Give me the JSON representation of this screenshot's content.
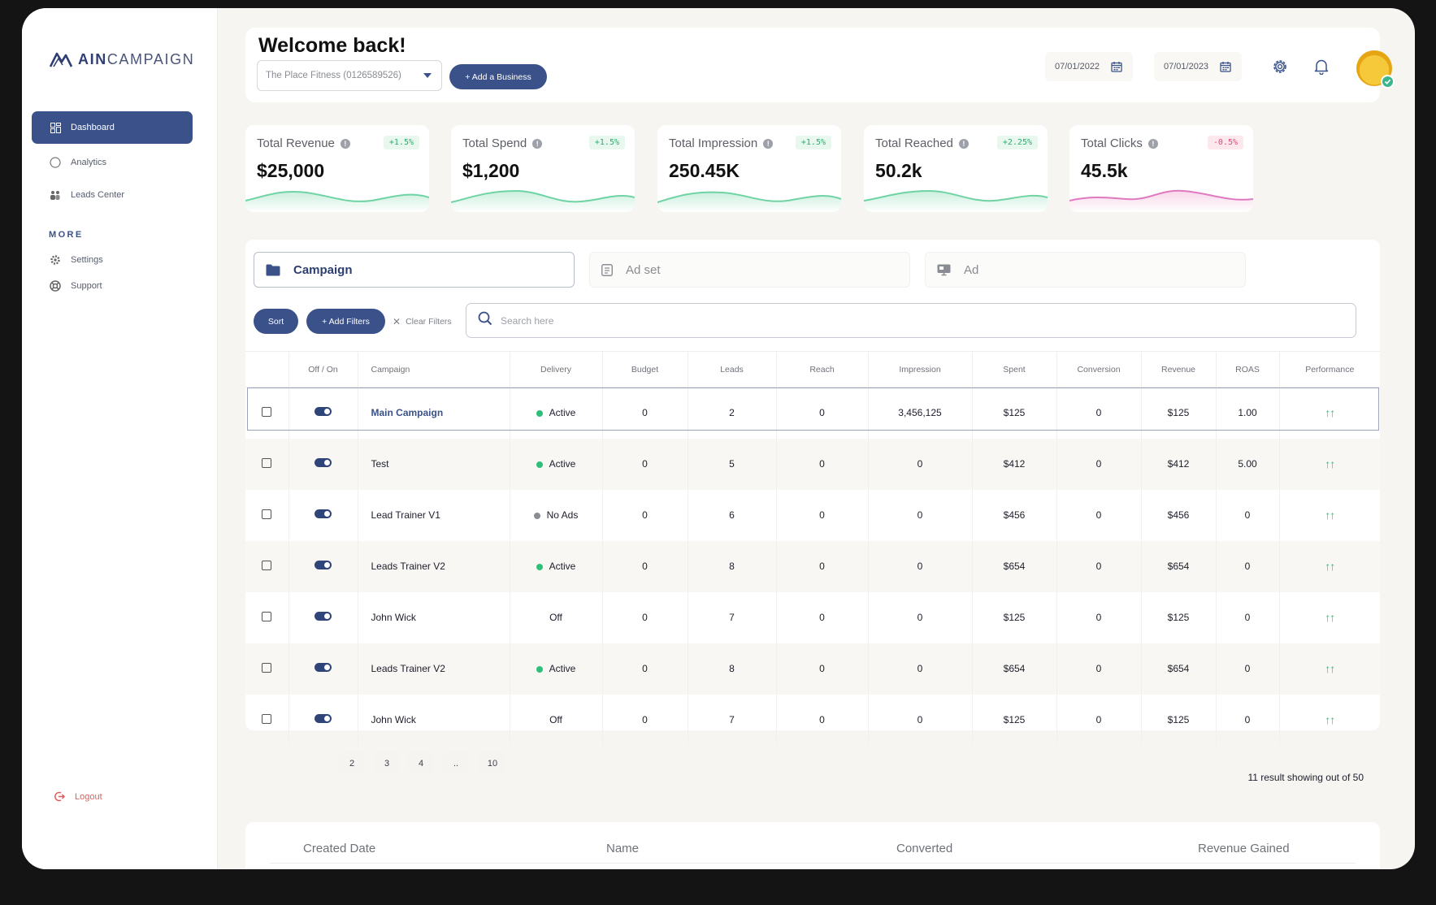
{
  "app": {
    "logo_bold": "AIN",
    "logo_light": "CAMPAIGN"
  },
  "sidebar": {
    "items": [
      {
        "label": "Dashboard",
        "icon": "grid-icon",
        "active": true
      },
      {
        "label": "Analytics",
        "icon": "circle-icon"
      },
      {
        "label": "Leads Center",
        "icon": "people-icon"
      }
    ],
    "more_label": "MORE",
    "more_items": [
      {
        "label": "Settings",
        "icon": "gear-icon"
      },
      {
        "label": "Support",
        "icon": "lifebuoy-icon"
      }
    ],
    "logout_label": "Logout"
  },
  "header": {
    "welcome": "Welcome back!",
    "business_select": "The Place Fitness (0126589526)",
    "add_business": "+ Add a Business",
    "date_from": "07/01/2022",
    "date_to": "07/01/2023"
  },
  "stats": [
    {
      "label": "Total Revenue",
      "value": "$25,000",
      "change": "+1.5%",
      "trend": "pos"
    },
    {
      "label": "Total Spend",
      "value": "$1,200",
      "change": "+1.5%",
      "trend": "pos"
    },
    {
      "label": "Total Impression",
      "value": "250.45K",
      "change": "+1.5%",
      "trend": "pos"
    },
    {
      "label": "Total Reached",
      "value": "50.2k",
      "change": "+2.25%",
      "trend": "pos"
    },
    {
      "label": "Total Clicks",
      "value": "45.5k",
      "change": "-0.5%",
      "trend": "neg"
    }
  ],
  "colors": {
    "accent": "#3a518a",
    "positive": "#2fbf7a",
    "negative": "#e04a7b"
  },
  "tabs": [
    "Campaign",
    "Ad set",
    "Ad"
  ],
  "toolbar": {
    "sort": "Sort",
    "add_filters": "+ Add Filters",
    "clear_filters": "Clear Filters",
    "search_placeholder": "Search here"
  },
  "table": {
    "headers": [
      "",
      "Off / On",
      "Campaign",
      "Delivery",
      "Budget",
      "Leads",
      "Reach",
      "Impression",
      "Spent",
      "Conversion",
      "Revenue",
      "ROAS",
      "Performance"
    ],
    "rows": [
      {
        "campaign": "Main Campaign",
        "delivery": "Active",
        "budget": "0",
        "leads": "2",
        "reach": "0",
        "impression": "3,456,125",
        "spent": "$125",
        "conversion": "0",
        "revenue": "$125",
        "roas": "1.00",
        "performance": "↑↑"
      },
      {
        "campaign": "Test",
        "delivery": "Active",
        "budget": "0",
        "leads": "5",
        "reach": "0",
        "impression": "0",
        "spent": "$412",
        "conversion": "0",
        "revenue": "$412",
        "roas": "5.00",
        "performance": "↑↑"
      },
      {
        "campaign": "Lead Trainer V1",
        "delivery": "No Ads",
        "budget": "0",
        "leads": "6",
        "reach": "0",
        "impression": "0",
        "spent": "$456",
        "conversion": "0",
        "revenue": "$456",
        "roas": "0",
        "performance": "↑↑"
      },
      {
        "campaign": "Leads Trainer V2",
        "delivery": "Active",
        "budget": "0",
        "leads": "8",
        "reach": "0",
        "impression": "0",
        "spent": "$654",
        "conversion": "0",
        "revenue": "$654",
        "roas": "0",
        "performance": "↑↑"
      },
      {
        "campaign": "John Wick",
        "delivery": "Off",
        "budget": "0",
        "leads": "7",
        "reach": "0",
        "impression": "0",
        "spent": "$125",
        "conversion": "0",
        "revenue": "$125",
        "roas": "0",
        "performance": "↑↑"
      },
      {
        "campaign": "Leads Trainer V2",
        "delivery": "Active",
        "budget": "0",
        "leads": "8",
        "reach": "0",
        "impression": "0",
        "spent": "$654",
        "conversion": "0",
        "revenue": "$654",
        "roas": "0",
        "performance": "↑↑"
      },
      {
        "campaign": "John Wick",
        "delivery": "Off",
        "budget": "0",
        "leads": "7",
        "reach": "0",
        "impression": "0",
        "spent": "$125",
        "conversion": "0",
        "revenue": "$125",
        "roas": "0",
        "performance": "↑↑"
      }
    ]
  },
  "pagination": {
    "pages": [
      "2",
      "3",
      "4",
      "..",
      "10"
    ],
    "result_text": "11 result showing out of 50"
  },
  "bottom_table": {
    "headers": [
      "Created Date",
      "Name",
      "Converted",
      "Revenue Gained"
    ]
  }
}
